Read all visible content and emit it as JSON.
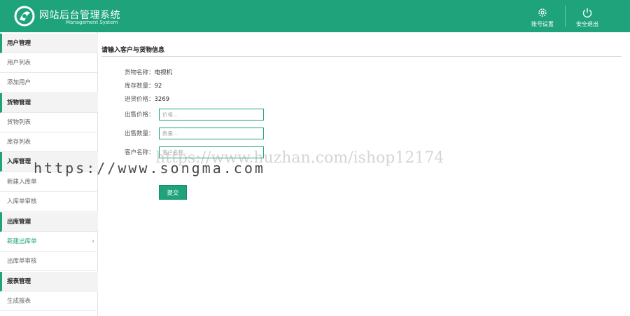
{
  "header": {
    "title": "网站后台管理系统",
    "subtitle": "Management System",
    "logo_icon": "leaf-logo-icon",
    "account_label": "账号设置",
    "account_icon": "gear-icon",
    "logout_label": "安全退出",
    "logout_icon": "power-icon",
    "color": "#1ea37a"
  },
  "sidebar": {
    "sections": [
      {
        "label": "用户管理",
        "items": [
          "用户列表",
          "添加用户"
        ]
      },
      {
        "label": "货物管理",
        "items": [
          "货物列表",
          "库存列表"
        ]
      },
      {
        "label": "入库管理",
        "items": [
          "新建入库单",
          "入库单审核"
        ]
      },
      {
        "label": "出库管理",
        "items": [
          "新建出库单",
          "出库单审核"
        ]
      },
      {
        "label": "报表管理",
        "items": [
          "生成报表"
        ]
      }
    ],
    "active_item": "新建出库单"
  },
  "main": {
    "title": "请输入客户与货物信息",
    "goods_name_label": "货物名称：",
    "goods_name": "电视机",
    "stock_qty_label": "库存数量：",
    "stock_qty": "92",
    "purchase_price_label": "进货价格：",
    "purchase_price": "3269",
    "sale_price_label": "出售价格：",
    "sale_price_placeholder": "价格...",
    "sale_qty_label": "出售数量：",
    "sale_qty_placeholder": "数量...",
    "customer_label": "客户名称：",
    "customer_placeholder": "客户名称...",
    "submit_label": "提交"
  },
  "watermarks": {
    "primary": "https://www.songma.com",
    "secondary": "https://www.huzhan.com/ishop12174"
  }
}
